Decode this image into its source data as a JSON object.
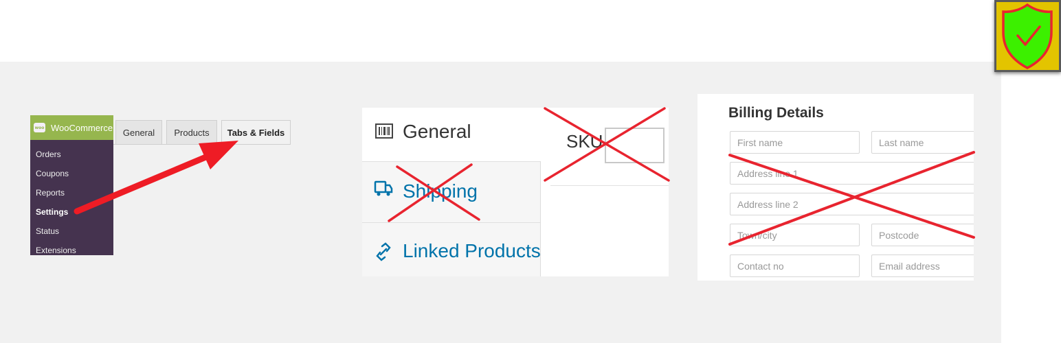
{
  "woocommerce": {
    "menu_title": "WooCommerce",
    "logo_text": "woo",
    "menu_items": [
      {
        "label": "Orders",
        "active": false
      },
      {
        "label": "Coupons",
        "active": false
      },
      {
        "label": "Reports",
        "active": false
      },
      {
        "label": "Settings",
        "active": true
      },
      {
        "label": "Status",
        "active": false
      },
      {
        "label": "Extensions",
        "active": false
      }
    ],
    "tabs": [
      {
        "label": "General",
        "active": false
      },
      {
        "label": "Products",
        "active": false
      },
      {
        "label": "Tabs & Fields",
        "active": true
      }
    ]
  },
  "product_data": {
    "tabs": [
      {
        "label": "General",
        "icon": "barcode-icon",
        "color": "#333333"
      },
      {
        "label": "Shipping",
        "icon": "truck-icon",
        "color": "#0073aa"
      },
      {
        "label": "Linked Products",
        "icon": "link-icon",
        "color": "#0073aa"
      }
    ],
    "sku_label": "SKU"
  },
  "billing": {
    "title": "Billing Details",
    "fields": {
      "first_name": "First name",
      "last_name": "Last name",
      "address_1": "Address line 1",
      "address_2": "Address line 2",
      "city": "Town/city",
      "postcode": "Postcode",
      "contact": "Contact no",
      "email": "Email address"
    }
  },
  "colors": {
    "woo_purple": "#45334f",
    "woo_green": "#96b64e",
    "cross_red": "#e8242f",
    "arrow_red": "#ee1c25",
    "badge_yellow": "#e3c400",
    "shield_green": "#3cf000",
    "link_blue": "#0073aa"
  }
}
